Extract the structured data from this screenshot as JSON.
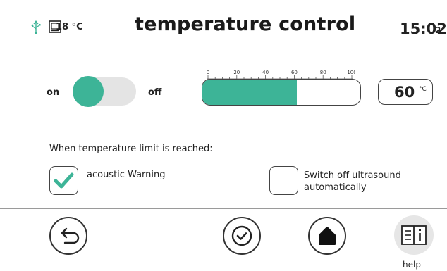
{
  "header": {
    "usb_icon": "usb-icon",
    "storage_icon": "storage-icon",
    "current_temp": "18 °C",
    "title": "temperature control",
    "time": "15:02",
    "time_suffix": "2"
  },
  "toggle": {
    "on_label": "on",
    "off_label": "off",
    "state": "on"
  },
  "slider": {
    "ticks": [
      "0",
      "20",
      "40",
      "60",
      "80",
      "100"
    ],
    "min": 0,
    "max": 100,
    "value": 60
  },
  "temperature_box": {
    "value": "60",
    "unit": "°C"
  },
  "limit_section": {
    "heading": "When temperature limit is reached:",
    "acoustic_label": "acoustic Warning",
    "acoustic_checked": true,
    "switch_off_label_line1": "Switch off ultrasound",
    "switch_off_label_line2": "automatically",
    "switch_off_checked": false
  },
  "footer": {
    "back_icon": "back-icon",
    "confirm_icon": "confirm-check-icon",
    "home_icon": "home-icon",
    "help_icon": "book-help-icon",
    "help_label": "help"
  },
  "colors": {
    "accent": "#3db497",
    "toggle_track": "#e4e4e4",
    "border": "#444444"
  }
}
